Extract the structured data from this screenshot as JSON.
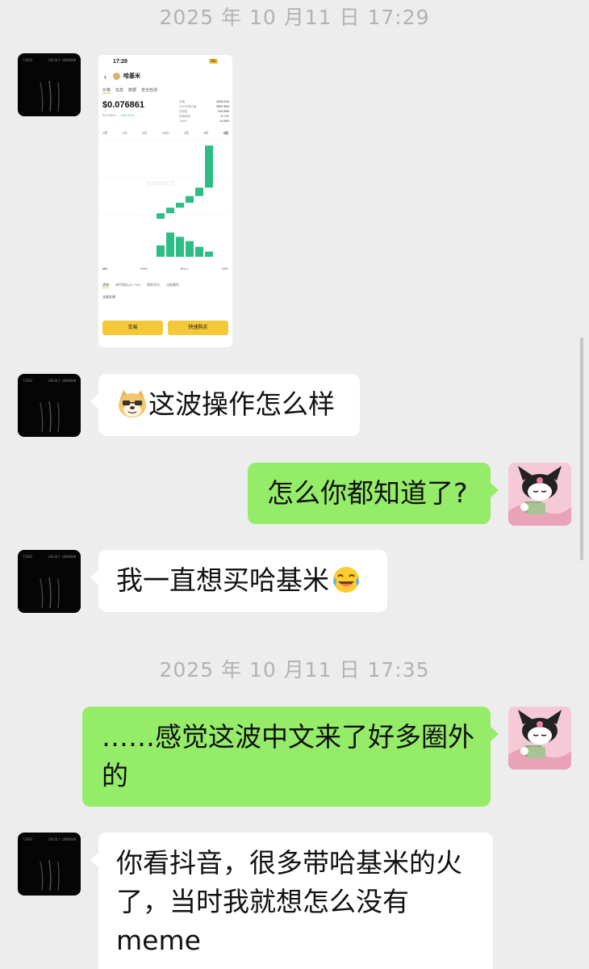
{
  "messages": {
    "timestamp_1": "2025 年 10 月11 日  17:29",
    "timestamp_2": "2025 年 10 月11 日  17:35",
    "msg_1": "这波操作怎么样",
    "msg_2": "怎么你都知道了?",
    "msg_3": "我一直想买哈基米",
    "msg_4_line1": "……感觉这波中文来了好多圈外",
    "msg_4_line2": "的",
    "msg_5_line1": "你看抖音，很多带哈基米的火",
    "msg_5_line2": "了，当时我就想怎么没有",
    "msg_5_line3": "meme"
  },
  "contact_avatar": {
    "tag_left": "TIKED",
    "tag_right": "BOLDLY UNKNOWN"
  },
  "screenshot": {
    "time": "17:28",
    "status": "5G",
    "token_name": "哈基米",
    "tabs": [
      "价格",
      "信息",
      "数据",
      "安全检测"
    ],
    "price": "$0.076861",
    "sub_price": "¥0.54802",
    "change": "+181.87%",
    "stats_labels": [
      "市值",
      "24小时成交量",
      "流动性",
      "持有地址",
      "Top10"
    ],
    "stats_values": [
      "¥539.02M",
      "¥852.38M",
      "¥19.89M",
      "11.71K",
      "14.08%"
    ],
    "intervals": [
      "1秒",
      "1分",
      "5分",
      "15分",
      "1时",
      "4时",
      "1日"
    ],
    "indicators": [
      "MA",
      "EMA",
      "BOLL",
      "SAR"
    ],
    "bottom_tabs": [
      "活动",
      "持币地址(11.71K)",
      "我的仓位",
      "当前委托"
    ],
    "filter": "全部交易",
    "buy_label": "交易",
    "quick_buy_label": "快速购买",
    "watermark": "BINANCE",
    "colors": {
      "up": "#2ebd85",
      "accent": "#f3c93a"
    }
  },
  "chart_data": {
    "type": "candlestick",
    "title": "",
    "candles": [
      {
        "open": 0.0095,
        "close": 0.0128
      },
      {
        "open": 0.0128,
        "close": 0.0161
      },
      {
        "open": 0.0161,
        "close": 0.019
      },
      {
        "open": 0.019,
        "close": 0.023
      },
      {
        "open": 0.023,
        "close": 0.028
      },
      {
        "open": 0.028,
        "close": 0.053
      }
    ],
    "volume": [
      40,
      85,
      70,
      55,
      35,
      18
    ]
  }
}
